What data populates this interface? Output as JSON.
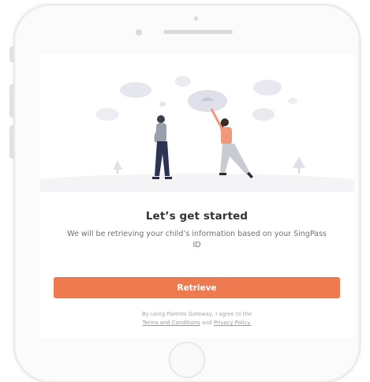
{
  "screen": {
    "title": "Let’s get started",
    "subtitle": "We will be retrieving your child’s information based on your SingPass ID",
    "retrieve_button": "Retrieve",
    "consent": {
      "prefix": "By using Parents Gateway, I agree to the",
      "terms_link": "Terms and Conditions",
      "connector": "and",
      "privacy_link": "Privacy Policy."
    }
  },
  "colors": {
    "accent": "#ee7a4f",
    "title_text": "#333333",
    "body_text": "#707070"
  },
  "icons": [
    "side-button",
    "camera",
    "speaker",
    "home-button"
  ]
}
